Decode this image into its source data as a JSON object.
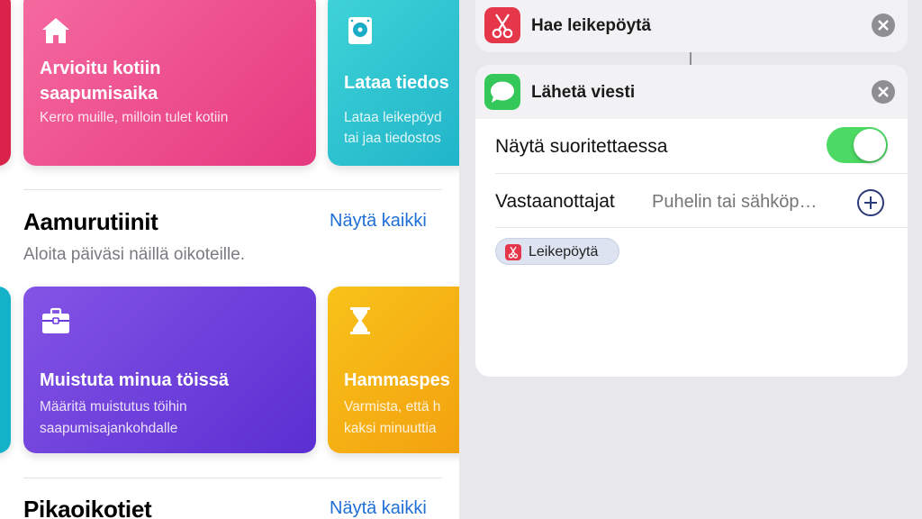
{
  "gallery": {
    "cards_top": [
      {
        "title": "Arvioitu kotiin saapumisaika",
        "title_line1": "Arvioitu kotiin",
        "title_line2": "saapumisaika",
        "subtitle": "Kerro muille, milloin tulet kotiin",
        "icon": "house-icon",
        "color": "#e6387f"
      },
      {
        "title": "Lataa tiedos",
        "subtitle_line1": "Lataa leikepöyd",
        "subtitle_line2": "tai jaa tiedostos",
        "icon": "drive-icon",
        "color": "#1aaec6"
      }
    ],
    "section1": {
      "title": "Aamurutiinit",
      "subtitle": "Aloita päiväsi näillä oikoteille.",
      "see_all": "Näytä kaikki"
    },
    "cards_bottom": [
      {
        "title": "Muistuta minua töissä",
        "subtitle_line1": "Määritä muistutus töihin",
        "subtitle_line2": "saapumisajankohdalle",
        "icon": "briefcase-icon",
        "color": "#5b2ed1"
      },
      {
        "title": "Hammaspes",
        "subtitle_line1": "Varmista, että h",
        "subtitle_line2": "kaksi minuuttia",
        "icon": "hourglass-icon",
        "color": "#f29a0c"
      }
    ],
    "section2": {
      "title": "Pikaoikotiet",
      "see_all": "Näytä kaikki"
    }
  },
  "editor": {
    "action_clipboard": {
      "title": "Hae leikepöytä",
      "icon": "scissors-icon",
      "color": "#e6364a"
    },
    "action_message": {
      "title": "Lähetä viesti",
      "icon": "message-bubble-icon",
      "color": "#34c759",
      "show_when_run_label": "Näytä suoritettaessa",
      "show_when_run": true,
      "recipients_label": "Vastaanottajat",
      "recipients_placeholder": "Puhelin tai sähköp…",
      "variable_token": "Leikepöytä"
    }
  }
}
